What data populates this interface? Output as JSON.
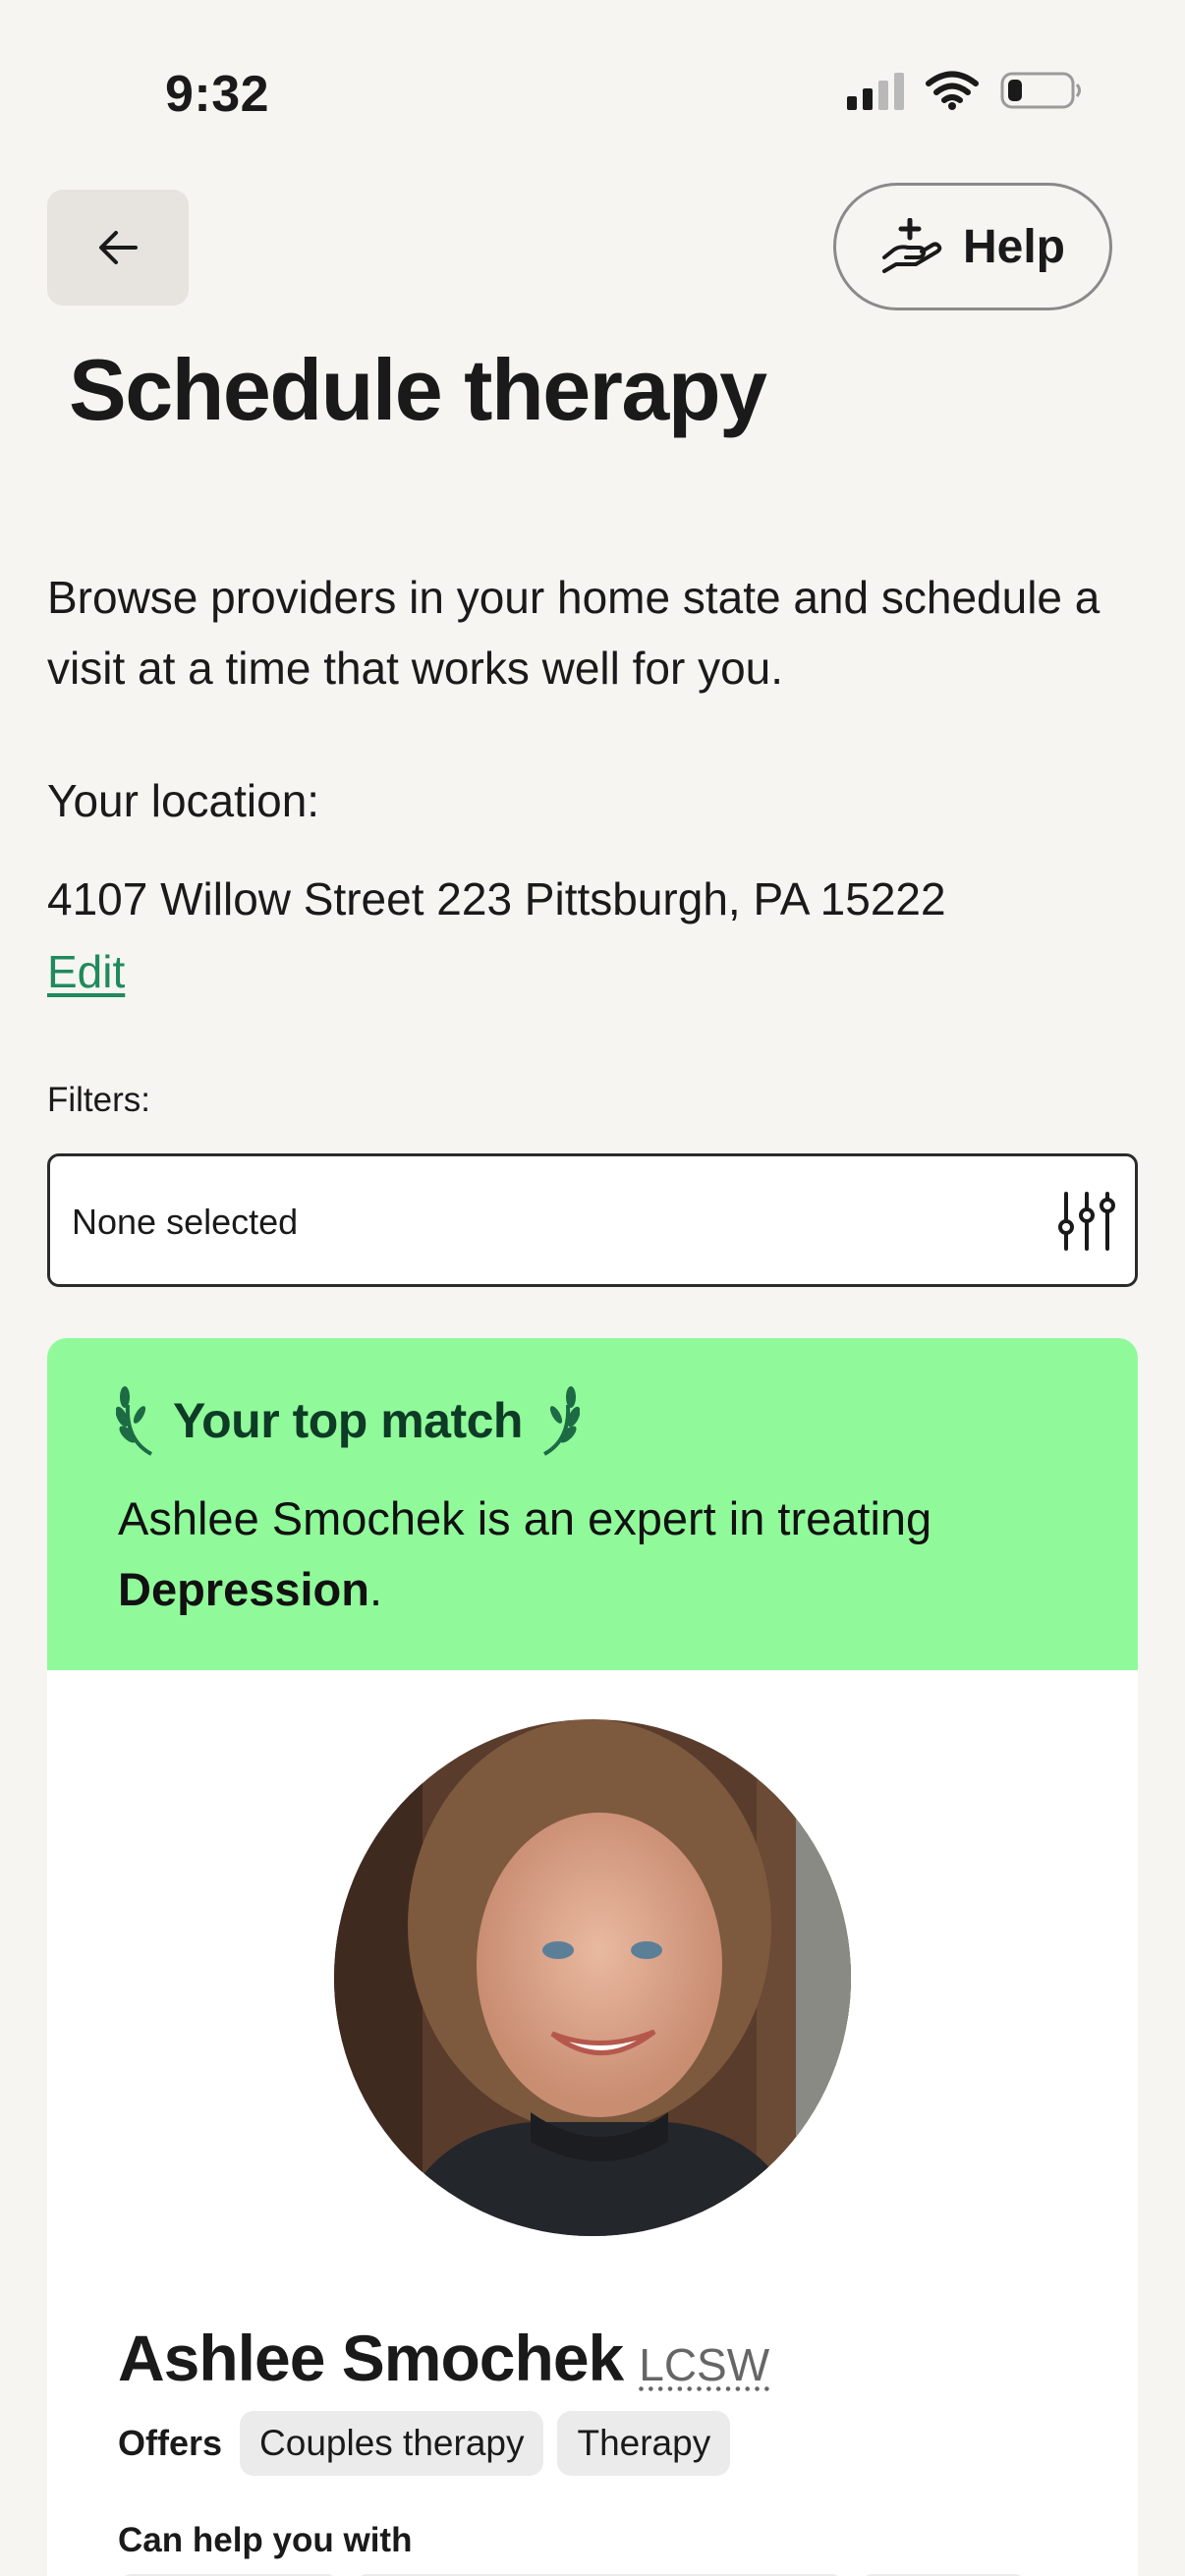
{
  "status_bar": {
    "time": "9:32"
  },
  "header": {
    "help_label": "Help"
  },
  "page": {
    "title": "Schedule therapy",
    "intro": "Browse providers in your home state and schedule a visit at a time that works well for you.",
    "location_label": "Your location:",
    "location_value": "4107 Willow Street 223 Pittsburgh, PA 15222",
    "edit_label": "Edit",
    "filters_label": "Filters:",
    "filters_value": "None selected"
  },
  "match": {
    "heading": "Your top match",
    "text_prefix": "Ashlee Smochek is an expert in treating ",
    "condition": "Depression",
    "text_suffix": "."
  },
  "provider": {
    "name": "Ashlee Smochek",
    "credential": "LCSW",
    "offers_label": "Offers",
    "offers": [
      "Couples therapy",
      "Therapy"
    ],
    "help_label": "Can help you with"
  },
  "colors": {
    "background": "#f6f5f2",
    "accent_green": "#1f8a5c",
    "match_banner": "#90fa9a"
  },
  "icons": [
    "back-arrow-icon",
    "help-hand-icon",
    "filter-sliders-icon",
    "laurel-icon",
    "signal-icon",
    "wifi-icon",
    "battery-icon"
  ]
}
